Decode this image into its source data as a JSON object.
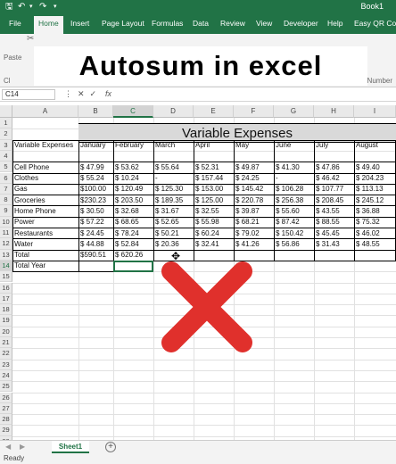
{
  "titlebar": {
    "save_icon": "save-icon",
    "undo_icon": "undo-icon",
    "book": "Book1"
  },
  "tabs": [
    "File",
    "Home",
    "Insert",
    "Page Layout",
    "Formulas",
    "Data",
    "Review",
    "View",
    "Developer",
    "Help",
    "Easy QR Code"
  ],
  "ribbon": {
    "paste_label": "Paste",
    "clipboard_short": "Cl",
    "number_short": "Number"
  },
  "banner": {
    "text": "Autosum in excel"
  },
  "formula_bar": {
    "name_box": "C14",
    "fx": "fx"
  },
  "columns": [
    "A",
    "B",
    "C",
    "D",
    "E",
    "F",
    "G",
    "H",
    "I"
  ],
  "rows": [
    "1",
    "2",
    "3",
    "4",
    "5",
    "6",
    "7",
    "8",
    "9",
    "10",
    "11",
    "12",
    "13",
    "14",
    "15",
    "16",
    "17",
    "18",
    "19",
    "20",
    "21",
    "22",
    "23",
    "24",
    "25",
    "26",
    "27",
    "28",
    "29",
    "30"
  ],
  "sheet": {
    "title": "Variable Expenses",
    "headers": [
      "Variable Expenses",
      "January",
      "February",
      "March",
      "April",
      "May",
      "June",
      "July",
      "August"
    ],
    "data_rows": [
      {
        "label": "Cell Phone",
        "values": [
          "$ 47.99",
          "$ 53.62",
          "$ 55.64",
          "$ 52.31",
          "$ 49.87",
          "$ 41.30",
          "$ 47.86",
          "$ 49.40"
        ]
      },
      {
        "label": "Clothes",
        "values": [
          "$ 55.24",
          "$ 10.24",
          "-",
          "$ 157.44",
          "$ 24.25",
          "-",
          "$ 46.42",
          "$ 204.23"
        ]
      },
      {
        "label": "Gas",
        "values": [
          "$100.00",
          "$ 120.49",
          "$ 125.30",
          "$ 153.00",
          "$ 145.42",
          "$ 106.28",
          "$ 107.77",
          "$ 113.13"
        ]
      },
      {
        "label": "Groceries",
        "values": [
          "$230.23",
          "$ 203.50",
          "$ 189.35",
          "$ 125.00",
          "$ 220.78",
          "$ 256.38",
          "$ 208.45",
          "$ 245.12"
        ]
      },
      {
        "label": "Home Phone",
        "values": [
          "$ 30.50",
          "$ 32.68",
          "$ 31.67",
          "$ 32.55",
          "$ 39.87",
          "$ 55.60",
          "$ 43.55",
          "$ 36.88"
        ]
      },
      {
        "label": "Power",
        "values": [
          "$ 57.22",
          "$ 68.65",
          "$ 52.65",
          "$ 55.98",
          "$ 68.21",
          "$ 87.42",
          "$ 88.55",
          "$ 75.32"
        ]
      },
      {
        "label": "Restaurants",
        "values": [
          "$ 24.45",
          "$ 78.24",
          "$ 50.21",
          "$ 60.24",
          "$ 79.02",
          "$ 150.42",
          "$ 45.45",
          "$ 46.02"
        ]
      },
      {
        "label": "Water",
        "values": [
          "$ 44.88",
          "$ 52.84",
          "$ 20.36",
          "$ 32.41",
          "$ 41.26",
          "$ 56.86",
          "$ 31.43",
          "$ 48.55"
        ]
      }
    ],
    "total": {
      "label": "Total",
      "values": [
        "$590.51",
        "$ 620.26"
      ]
    },
    "total_year": {
      "label": "Total Year"
    }
  },
  "sheet_tabs": {
    "active": "Sheet1",
    "add": "+"
  },
  "status": {
    "text": "Ready"
  },
  "overlay": {
    "icon": "red-x-icon",
    "color": "#e0302c"
  },
  "colors": {
    "brand": "#217346",
    "accent_green": "#217346"
  }
}
